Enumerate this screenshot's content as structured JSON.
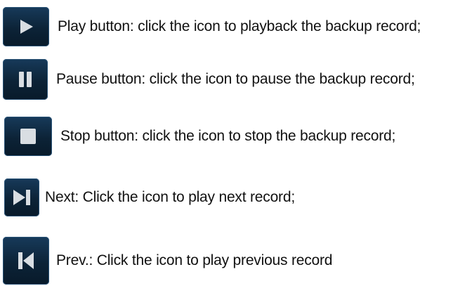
{
  "items": [
    {
      "icon": "play-icon",
      "text": "Play button: click the icon to playback the backup record;"
    },
    {
      "icon": "pause-icon",
      "text": "Pause button: click the icon to pause the backup record;"
    },
    {
      "icon": "stop-icon",
      "text": "Stop button: click the icon to stop the backup record;"
    },
    {
      "icon": "next-icon",
      "text": "Next: Click the icon to play next record;"
    },
    {
      "icon": "prev-icon",
      "text": "Prev.: Click the icon to play previous record"
    }
  ],
  "colors": {
    "button_bg": "#0c2337",
    "glyph": "#d9dee3",
    "text": "#111111"
  }
}
